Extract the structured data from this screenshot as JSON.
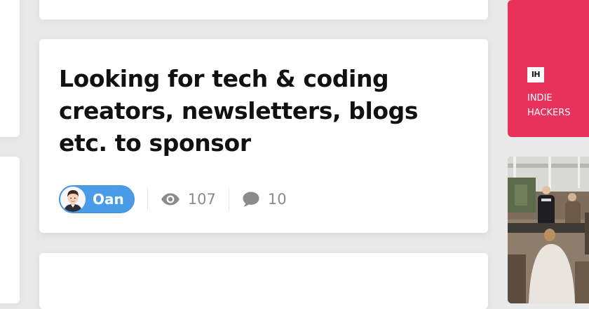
{
  "post": {
    "title": "Looking for tech & coding creators, newsletters, blogs etc. to sponsor",
    "author": "Oan",
    "views": "107",
    "comments": "10"
  },
  "sidebar": {
    "promo": {
      "logo_text": "IH",
      "name_line1": "INDIE",
      "name_line2": "HACKERS",
      "bg_color": "#e8325b"
    }
  },
  "colors": {
    "author_pill": "#4a9ce8",
    "meta_text": "#8b8b8b"
  },
  "icons": {
    "views": "eye-icon",
    "comments": "comment-icon"
  }
}
